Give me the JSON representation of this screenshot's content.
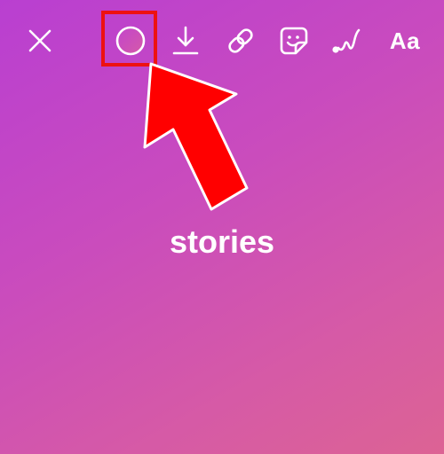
{
  "toolbar": {
    "close": {
      "icon": "close-icon"
    },
    "color": {
      "icon": "color-circle-icon",
      "color": "#c94bbe"
    },
    "download": {
      "icon": "download-icon"
    },
    "link": {
      "icon": "link-icon"
    },
    "sticker": {
      "icon": "sticker-icon"
    },
    "draw": {
      "icon": "draw-icon"
    },
    "text": {
      "label": "Aa"
    }
  },
  "annotation": {
    "highlight_color": "#ee1111",
    "arrow_color": "#ff0000",
    "target": "color"
  },
  "story": {
    "text": "stories"
  },
  "background": {
    "gradient_start": "#b93fd1",
    "gradient_end": "#dc6394"
  }
}
